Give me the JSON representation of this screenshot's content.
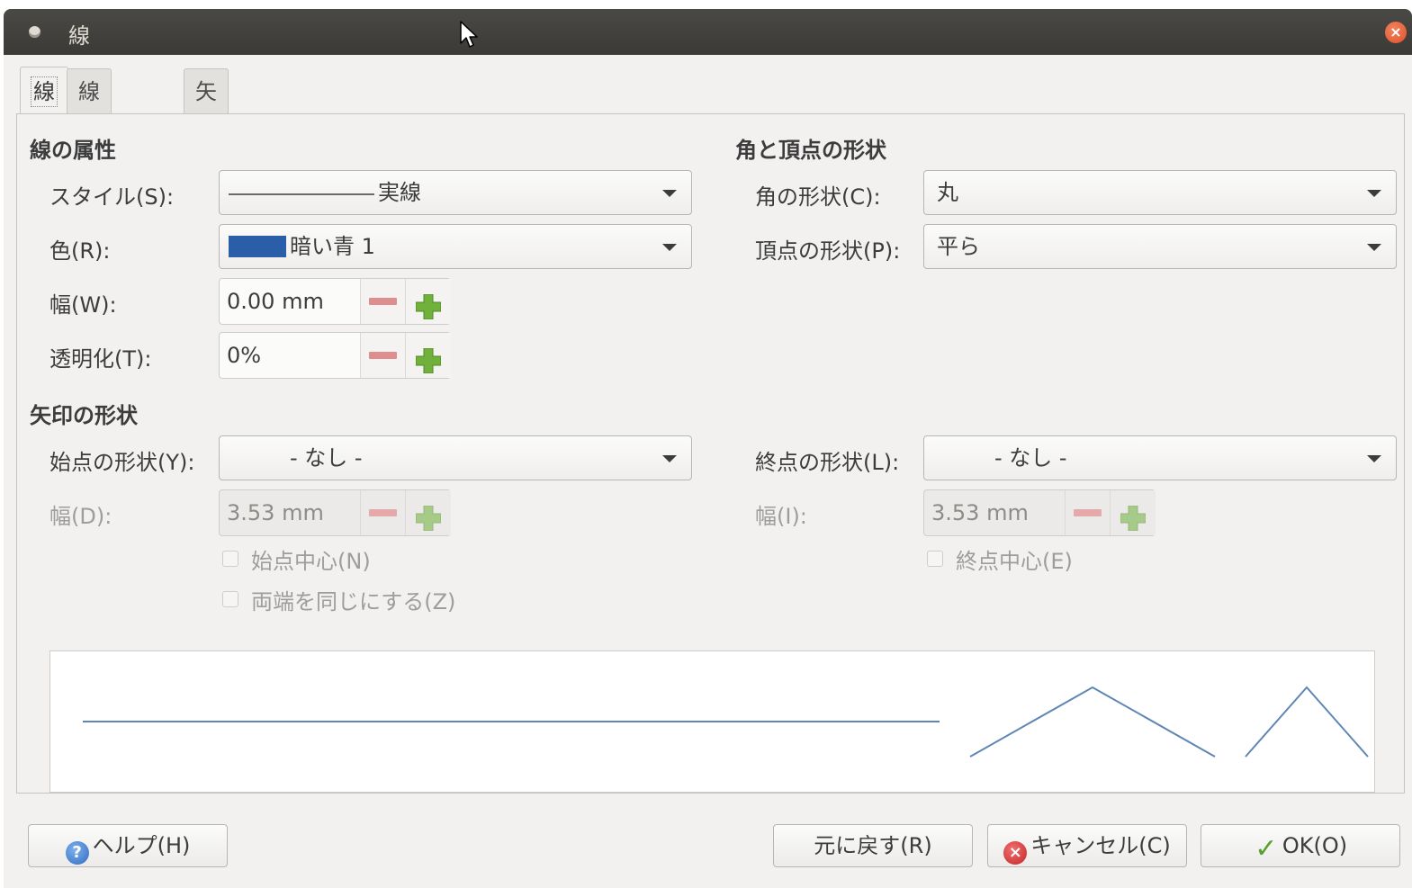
{
  "window": {
    "title": "線",
    "close_icon": "close-icon"
  },
  "tabs": [
    {
      "label": "線",
      "active": true
    },
    {
      "label": "線の形状",
      "active": false
    },
    {
      "label": "矢印の形状",
      "active": false
    }
  ],
  "line_properties": {
    "title": "線の属性",
    "style_label": "スタイル(S):",
    "style_value": "実線",
    "color_label": "色(R):",
    "color_value": "暗い青 1",
    "color_swatch": "#2a5ea8",
    "width_label": "幅(W):",
    "width_value": "0.00 mm",
    "transparency_label": "透明化(T):",
    "transparency_value": "0%"
  },
  "corner_cap": {
    "title": "角と頂点の形状",
    "corner_label": "角の形状(C):",
    "corner_value": "丸",
    "cap_label": "頂点の形状(P):",
    "cap_value": "平ら"
  },
  "arrow": {
    "title": "矢印の形状",
    "start_label": "始点の形状(Y):",
    "start_value": "- なし -",
    "end_label": "終点の形状(L):",
    "end_value": "- なし -",
    "start_width_label": "幅(D):",
    "start_width_value": "3.53 mm",
    "end_width_label": "幅(I):",
    "end_width_value": "3.53 mm",
    "start_center_label": "始点中心(N)",
    "end_center_label": "終点中心(E)",
    "sync_ends_label": "両端を同じにする(Z)"
  },
  "buttons": {
    "help": "ヘルプ(H)",
    "reset": "元に戻す(R)",
    "cancel": "キャンセル(C)",
    "ok": "OK(O)"
  },
  "colors": {
    "preview_line": "#5f86b4",
    "titlebar": "#3c3b37"
  }
}
